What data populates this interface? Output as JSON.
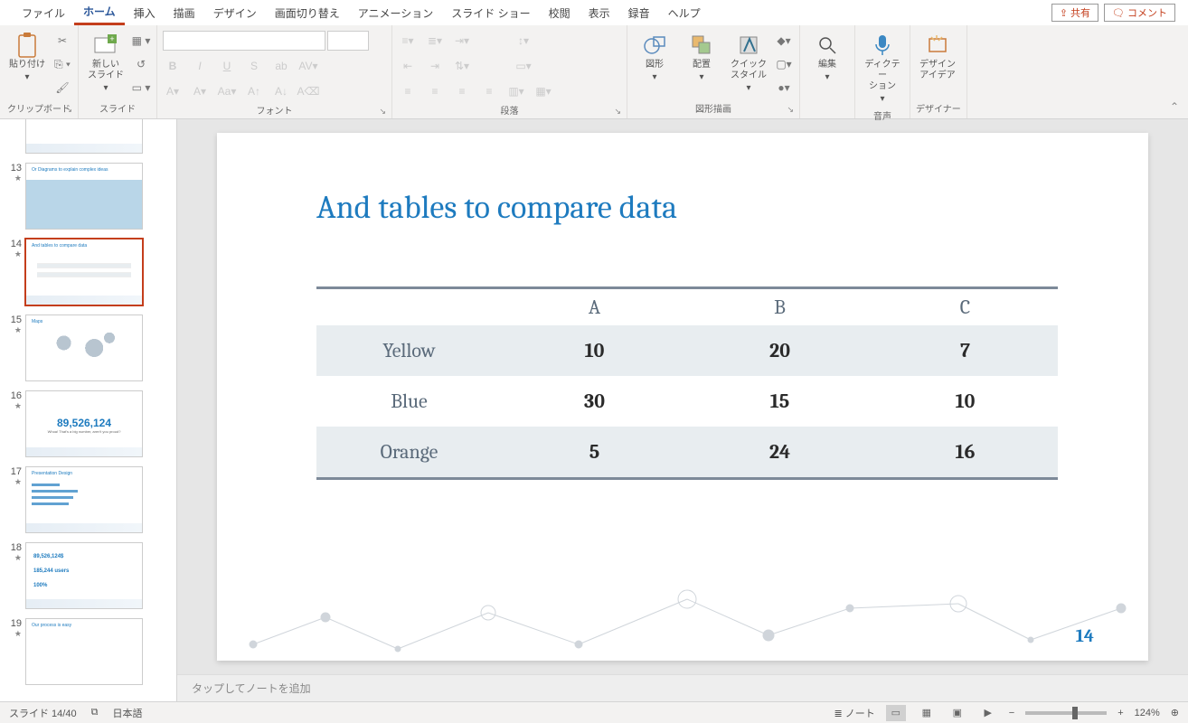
{
  "tabs": {
    "file": "ファイル",
    "home": "ホーム",
    "insert": "挿入",
    "draw": "描画",
    "design": "デザイン",
    "transitions": "画面切り替え",
    "animations": "アニメーション",
    "slideshow": "スライド ショー",
    "review": "校閲",
    "view": "表示",
    "recording": "録音",
    "help": "ヘルプ"
  },
  "topright": {
    "share": "共有",
    "comment": "コメント"
  },
  "ribbon": {
    "clipboard": {
      "paste": "貼り付け",
      "label": "クリップボード"
    },
    "slides": {
      "new_slide": "新しい\nスライド",
      "label": "スライド"
    },
    "font": {
      "label": "フォント"
    },
    "paragraph": {
      "label": "段落"
    },
    "drawing": {
      "shapes": "図形",
      "arrange": "配置",
      "quick_styles": "クイック\nスタイル",
      "label": "図形描画"
    },
    "editing": {
      "edit": "編集"
    },
    "voice": {
      "dictation": "ディクテー\nション",
      "label": "音声"
    },
    "designer": {
      "design_ideas": "デザイン\nアイデア",
      "label": "デザイナー"
    }
  },
  "thumbnails": [
    {
      "num": "13"
    },
    {
      "num": "14",
      "active": true
    },
    {
      "num": "15"
    },
    {
      "num": "16",
      "big_num": "89,526,124",
      "sub": "Whoa! That's a big number, aren't you proud?"
    },
    {
      "num": "17",
      "title": "Presentation Design"
    },
    {
      "num": "18",
      "l1": "89,526,124$",
      "l2": "185,244 users",
      "l3": "100%"
    },
    {
      "num": "19"
    }
  ],
  "slide": {
    "title": "And tables to compare data",
    "headers": [
      "",
      "A",
      "B",
      "C"
    ],
    "rows": [
      {
        "label": "Yellow",
        "a": "10",
        "b": "20",
        "c": "7"
      },
      {
        "label": "Blue",
        "a": "30",
        "b": "15",
        "c": "10"
      },
      {
        "label": "Orange",
        "a": "5",
        "b": "24",
        "c": "16"
      }
    ],
    "page_num": "14"
  },
  "thumb_titles": {
    "t13": "Or Diagrams to explain complex ideas",
    "t14": "And tables to compare data",
    "t15": "Maps",
    "t19": "Our process is easy"
  },
  "notes": {
    "placeholder": "タップしてノートを追加"
  },
  "statusbar": {
    "slide_count": "スライド 14/40",
    "language": "日本語",
    "notes_btn": "ノート",
    "zoom": "124%"
  },
  "chart_data": {
    "type": "table",
    "title": "And tables to compare data",
    "columns": [
      "A",
      "B",
      "C"
    ],
    "rows": [
      {
        "label": "Yellow",
        "values": [
          10,
          20,
          7
        ]
      },
      {
        "label": "Blue",
        "values": [
          30,
          15,
          10
        ]
      },
      {
        "label": "Orange",
        "values": [
          5,
          24,
          16
        ]
      }
    ]
  }
}
